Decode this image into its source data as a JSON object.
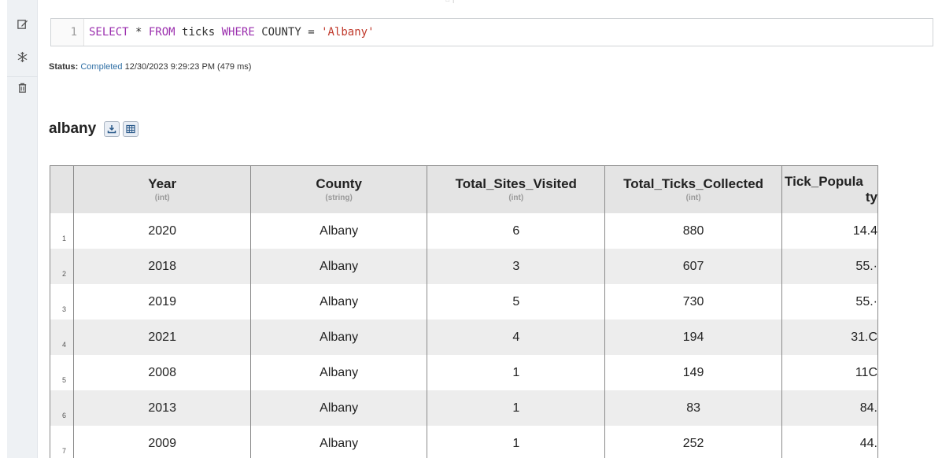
{
  "toolbar": {
    "items": [
      {
        "name": "edit",
        "icon": "edit-icon"
      },
      {
        "name": "freeze",
        "icon": "snowflake-icon"
      },
      {
        "name": "delete",
        "icon": "trash-icon"
      }
    ]
  },
  "editor": {
    "line_number": "1",
    "query": {
      "select": "SELECT",
      "star": " * ",
      "from": "FROM",
      "table": " ticks ",
      "where": "WHERE",
      "condition": " COUNTY = ",
      "value": "'Albany'"
    }
  },
  "status": {
    "label": "Status:",
    "state": "Completed",
    "timestamp": "12/30/2023 9:29:23 PM (479 ms)"
  },
  "result": {
    "name": "albany",
    "download_icon": "download-icon",
    "grid_icon": "table-grid-icon"
  },
  "table": {
    "columns": [
      {
        "name": "Year",
        "type": "(int)"
      },
      {
        "name": "County",
        "type": "(string)"
      },
      {
        "name": "Total_Sites_Visited",
        "type": "(int)"
      },
      {
        "name": "Total_Ticks_Collected",
        "type": "(int)"
      },
      {
        "name": "Tick_Popula",
        "name2": "ty",
        "type": ""
      }
    ],
    "rows": [
      {
        "n": "1",
        "year": "2020",
        "county": "Albany",
        "sites": "6",
        "ticks": "880",
        "pop": "14.4"
      },
      {
        "n": "2",
        "year": "2018",
        "county": "Albany",
        "sites": "3",
        "ticks": "607",
        "pop": "55.·"
      },
      {
        "n": "3",
        "year": "2019",
        "county": "Albany",
        "sites": "5",
        "ticks": "730",
        "pop": "55.·"
      },
      {
        "n": "4",
        "year": "2021",
        "county": "Albany",
        "sites": "4",
        "ticks": "194",
        "pop": "31.C"
      },
      {
        "n": "5",
        "year": "2008",
        "county": "Albany",
        "sites": "1",
        "ticks": "149",
        "pop": "11C"
      },
      {
        "n": "6",
        "year": "2013",
        "county": "Albany",
        "sites": "1",
        "ticks": "83",
        "pop": "84."
      },
      {
        "n": "7",
        "year": "2009",
        "county": "Albany",
        "sites": "1",
        "ticks": "252",
        "pop": "44."
      }
    ]
  }
}
